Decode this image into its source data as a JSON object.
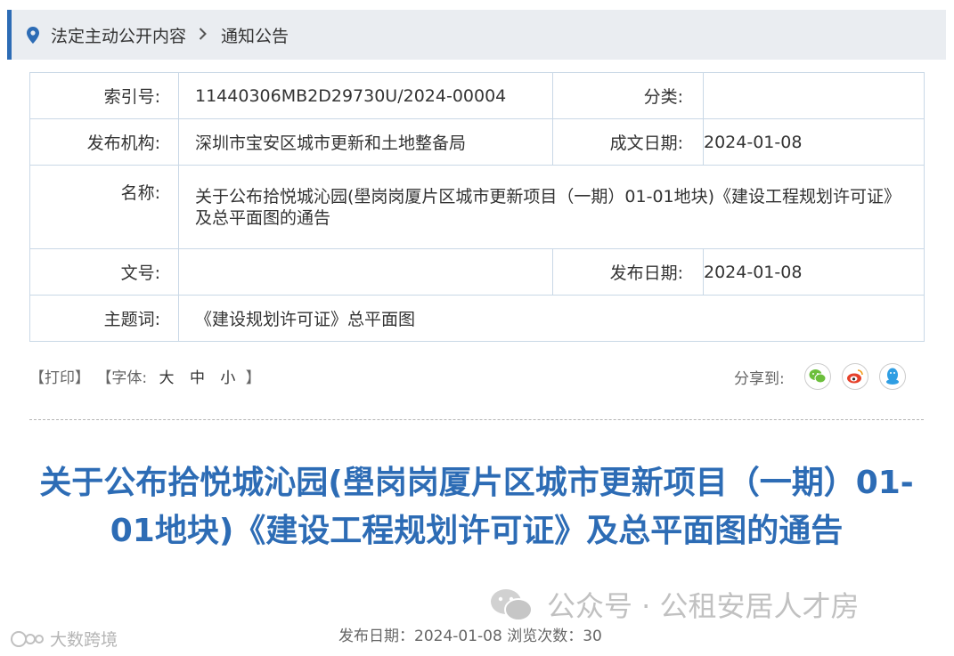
{
  "breadcrumb": {
    "item1": "法定主动公开内容",
    "item2": "通知公告"
  },
  "info": {
    "index_label": "索引号:",
    "index_value": "11440306MB2D29730U/2024-00004",
    "category_label": "分类:",
    "category_value": "",
    "publisher_label": "发布机构:",
    "publisher_value": "深圳市宝安区城市更新和土地整备局",
    "written_date_label": "成文日期:",
    "written_date_value": "2024-01-08",
    "name_label": "名称:",
    "name_value": "关于公布拾悦城沁园(壆岗岗厦片区城市更新项目（一期）01-01地块)《建设工程规划许可证》及总平面图的通告",
    "doc_no_label": "文号:",
    "doc_no_value": "",
    "publish_date_label": "发布日期:",
    "publish_date_value": "2024-01-08",
    "keywords_label": "主题词:",
    "keywords_value": "《建设规划许可证》总平面图"
  },
  "tools": {
    "print": "【打印】",
    "font_open": "【字体:",
    "large": "大",
    "medium": "中",
    "small": "小",
    "font_close": "】",
    "share_label": "分享到:",
    "share_icons": [
      "wechat-icon",
      "weibo-icon",
      "qq-icon"
    ]
  },
  "article": {
    "title": "关于公布拾悦城沁园(壆岗岗厦片区城市更新项目（一期）01-01地块)《建设工程规划许可证》及总平面图的通告",
    "meta": "发布日期：2024-01-08  浏览次数：30"
  },
  "watermarks": {
    "wechat": "公众号 · 公租安居人才房",
    "corner": "大数跨境"
  },
  "colors": {
    "accent": "#2d6cb5",
    "border": "#c9d8e6",
    "crumb_bg": "#eaedf1"
  }
}
